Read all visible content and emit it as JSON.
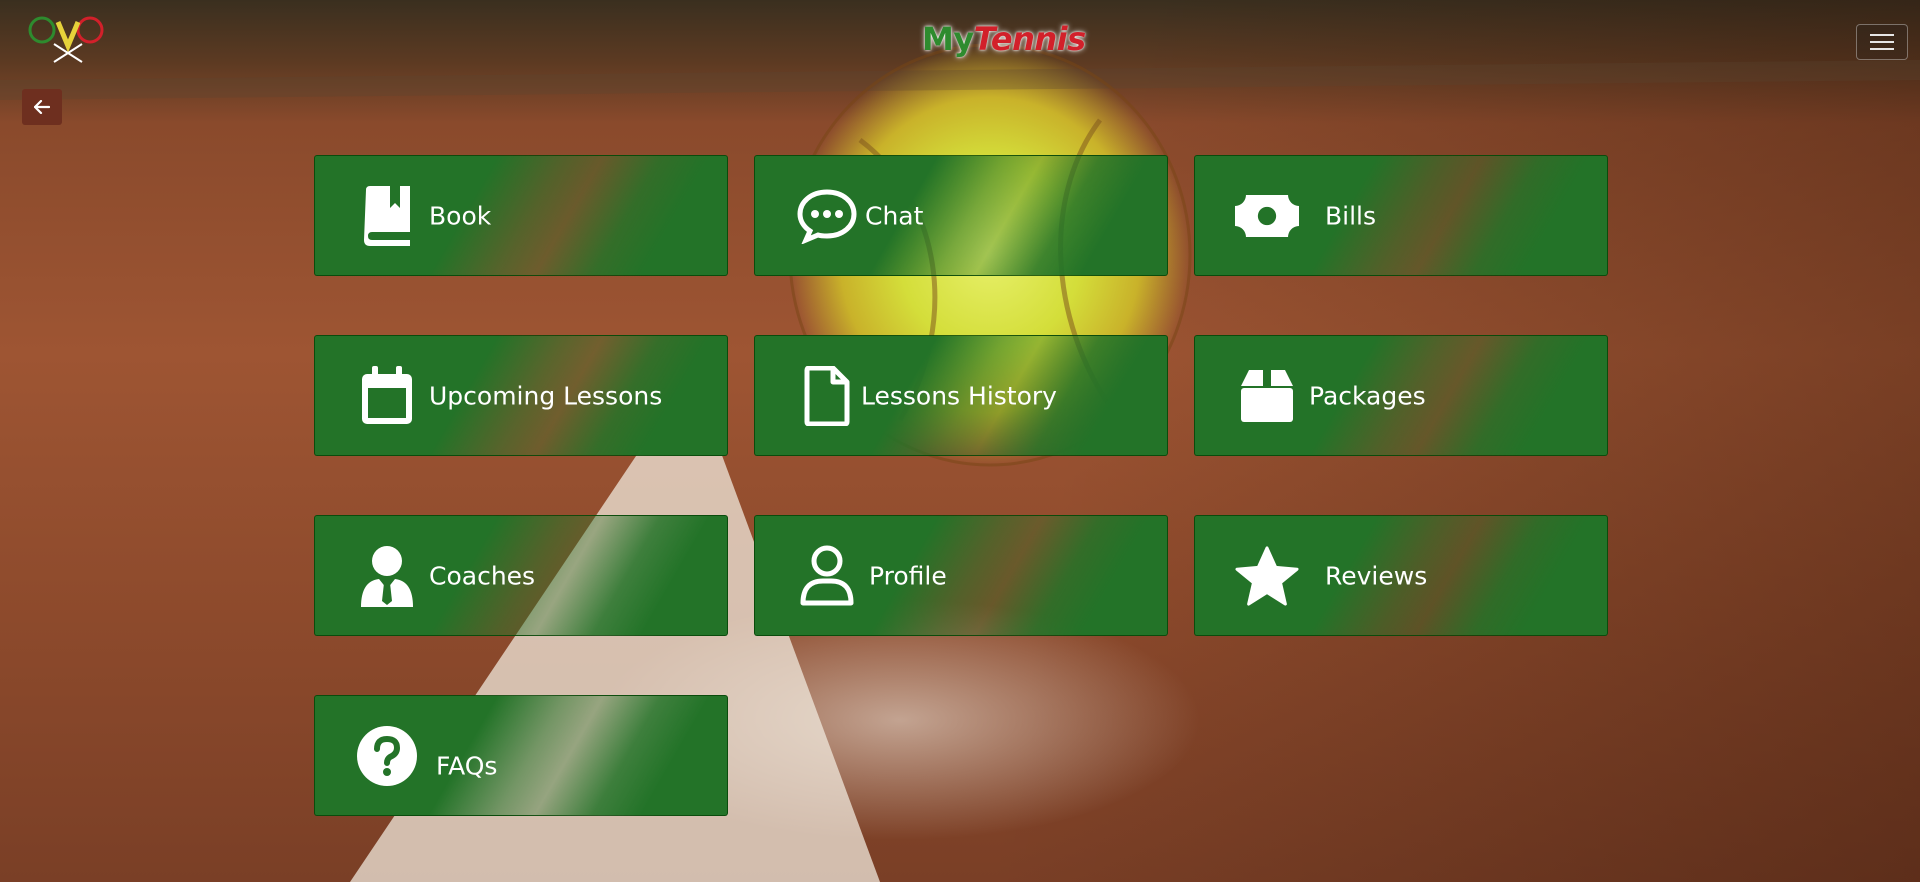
{
  "brand": {
    "my": "My",
    "tennis": "Tennis"
  },
  "nav": {
    "menu_icon": "hamburger-icon",
    "back_icon": "arrow-left-icon"
  },
  "tiles": [
    {
      "label": "Book",
      "icon": "book-icon"
    },
    {
      "label": "Chat",
      "icon": "chat-icon"
    },
    {
      "label": "Bills",
      "icon": "money-bill-icon"
    },
    {
      "label": "Upcoming Lessons",
      "icon": "calendar-icon"
    },
    {
      "label": "Lessons History",
      "icon": "file-icon"
    },
    {
      "label": "Packages",
      "icon": "box-icon"
    },
    {
      "label": "Coaches",
      "icon": "user-tie-icon"
    },
    {
      "label": "Profile",
      "icon": "user-icon"
    },
    {
      "label": "Reviews",
      "icon": "star-icon"
    },
    {
      "label": "FAQs",
      "icon": "question-circle-icon"
    }
  ],
  "colors": {
    "tile_green": "#237328",
    "brand_green": "#2e8b2e",
    "brand_red": "#d2202a",
    "back_button": "#6e2f1f"
  }
}
